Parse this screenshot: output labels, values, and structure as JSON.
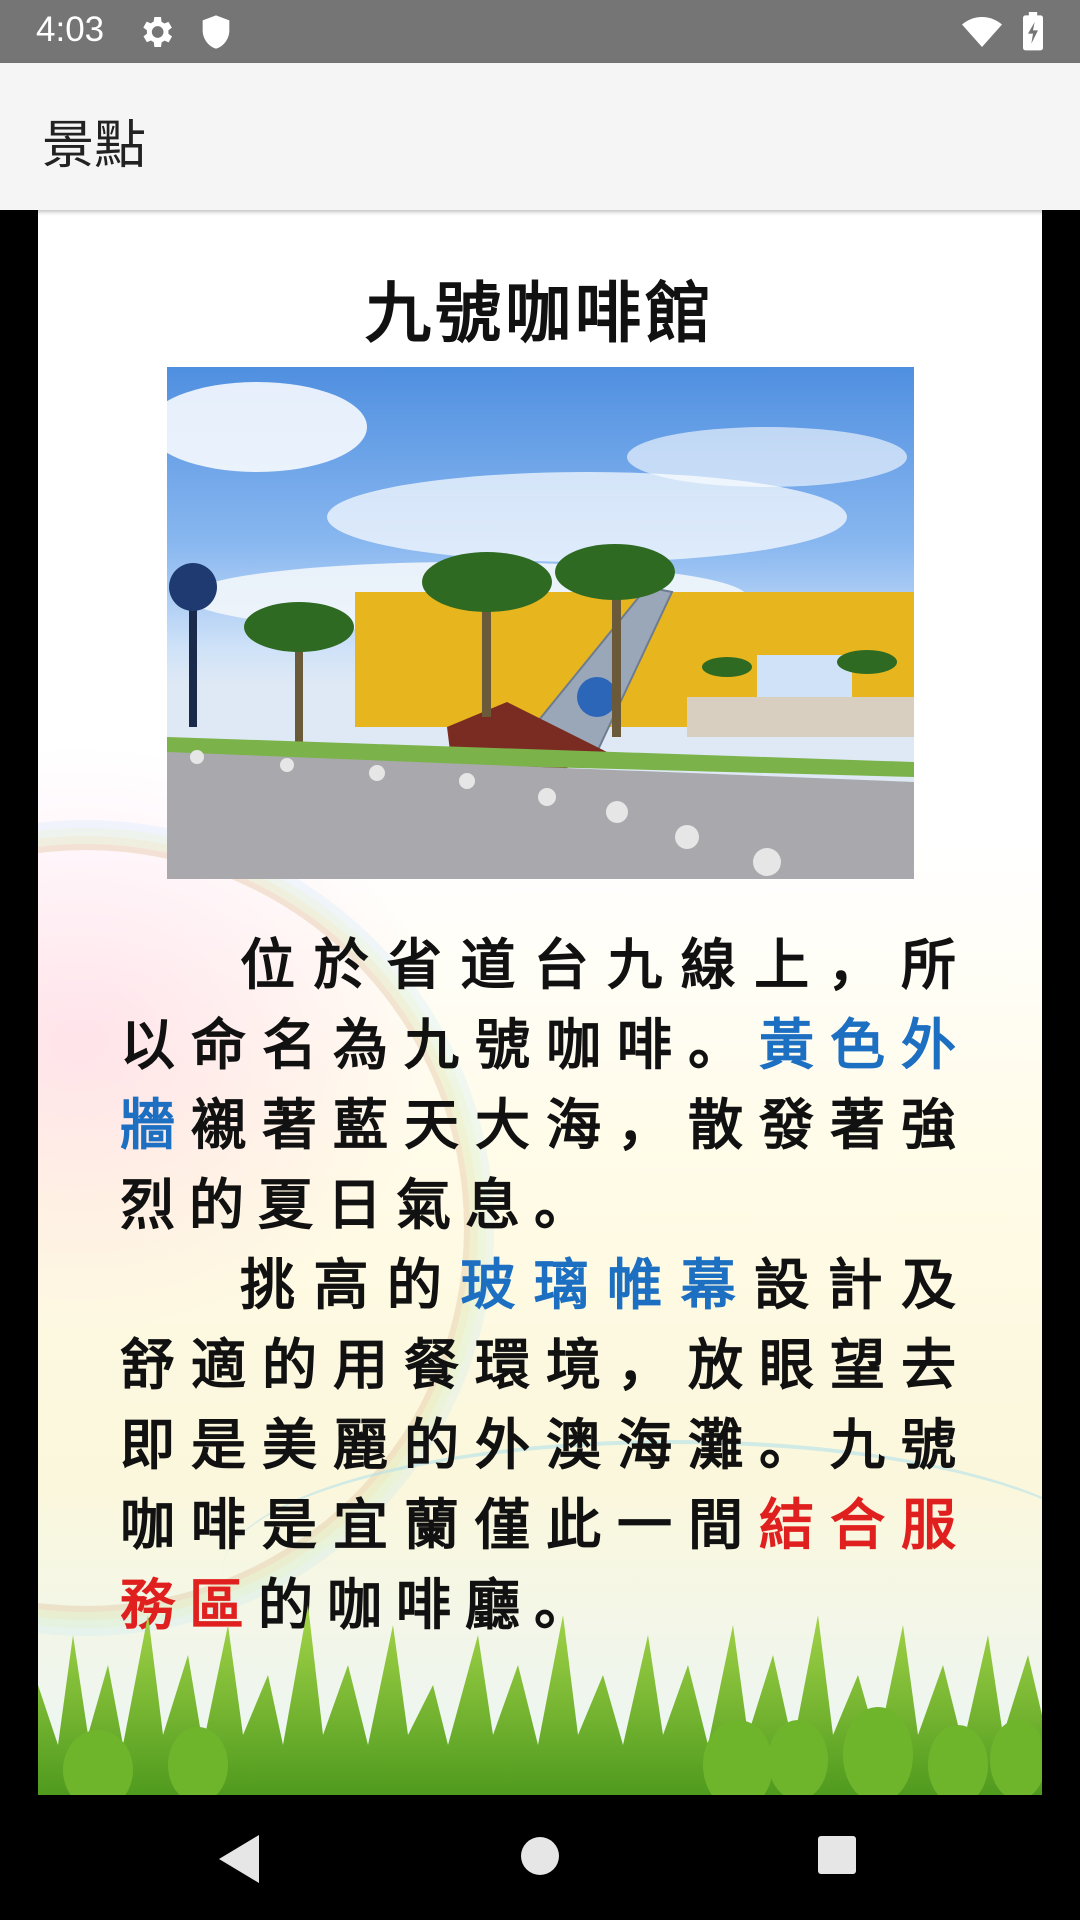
{
  "status_bar": {
    "time": "4:03",
    "icons": [
      "settings-gear-icon",
      "shield-icon",
      "wifi-icon",
      "battery-charging-icon"
    ]
  },
  "app_bar": {
    "title": "景點"
  },
  "poster": {
    "title": "九號咖啡館",
    "photo_alt": "Cafe photo with palm trees and yellow wall",
    "paragraph1": {
      "part1": "位於省道台九線上，所以命名為九號咖啡。",
      "highlight_blue": "黃色外牆",
      "part2": "襯著藍天大海，散發著強烈的夏日氣息。"
    },
    "paragraph2": {
      "part1": "挑高的",
      "highlight_blue": "玻璃帷幕",
      "part2": "設計及舒適的用餐環境，放眼望去即是美麗的外澳海灘。九號咖啡是宜蘭僅此一間",
      "highlight_red": "結合服務區",
      "part3": "的咖啡廳。"
    },
    "colors": {
      "blue_highlight": "#1d6fc2",
      "red_highlight": "#e0201e"
    }
  },
  "nav_bar": {
    "back": "back-triangle-icon",
    "home": "home-circle-icon",
    "recents": "recents-square-icon"
  }
}
